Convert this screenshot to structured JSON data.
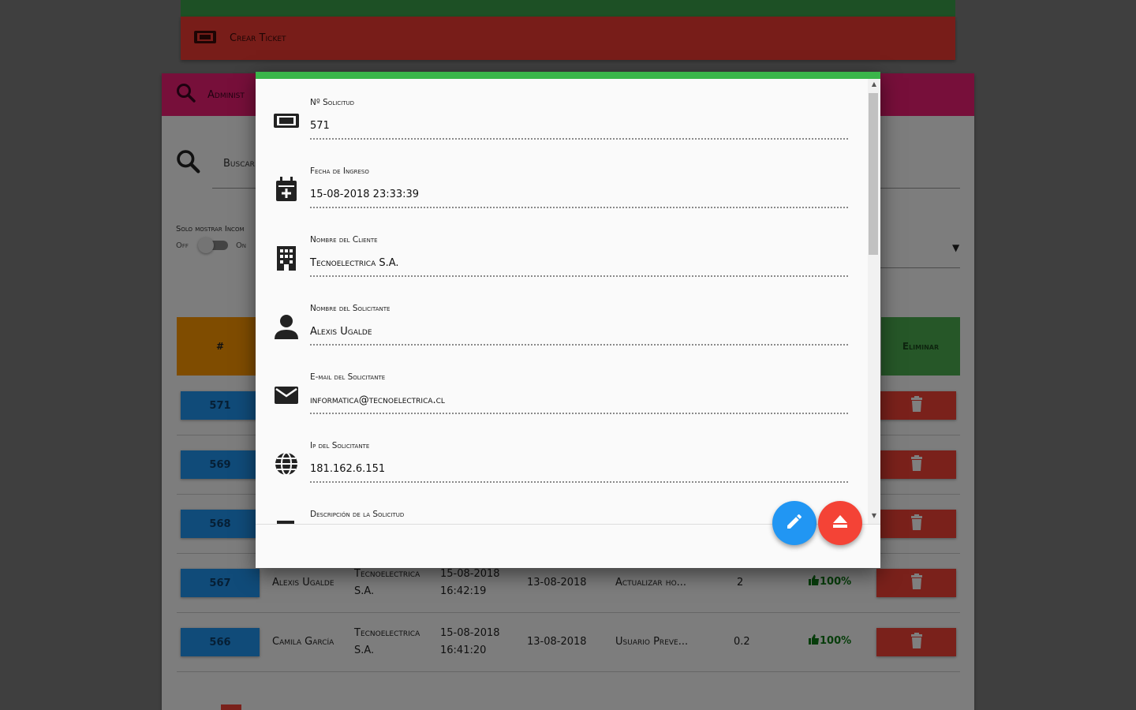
{
  "app": {
    "create_ticket_label": "Crear Ticket",
    "admin_label": "Administ",
    "search_label": "Buscar",
    "toggle_title": "Solo mostrar Incom",
    "toggle_off": "Off",
    "toggle_on": "On"
  },
  "table": {
    "header_hash": "#",
    "header_delete": "Eliminar",
    "rows": [
      {
        "num": "571"
      },
      {
        "num": "569"
      },
      {
        "num": "568"
      },
      {
        "num": "567",
        "solicitante": "Alexis Ugalde",
        "cliente_1": "Tecnoelectrica",
        "cliente_2": "S.A.",
        "ingreso_1": "15-08-2018",
        "ingreso_2": "16:42:19",
        "fecha": "13-08-2018",
        "descripcion": "Actualizar ho...",
        "horas": "2",
        "avance": "100%"
      },
      {
        "num": "566",
        "solicitante": "Camila García",
        "cliente_1": "Tecnoelectrica",
        "cliente_2": "S.A.",
        "ingreso_1": "15-08-2018",
        "ingreso_2": "16:41:20",
        "fecha": "13-08-2018",
        "descripcion": "Usuario Preve...",
        "horas": "0.2",
        "avance": "100%"
      }
    ]
  },
  "modal": {
    "fields": [
      {
        "label": "Nº Solicitud",
        "value": "571",
        "icon": "ticket-icon"
      },
      {
        "label": "Fecha de Ingreso",
        "value": "15-08-2018 23:33:39",
        "icon": "calendar-plus-icon"
      },
      {
        "label": "Nombre del Cliente",
        "value": "Tecnoelectrica S.A.",
        "icon": "building-icon"
      },
      {
        "label": "Nombre del Solicitante",
        "value": "Alexis Ugalde",
        "icon": "person-icon"
      },
      {
        "label": "E-mail del Solicitante",
        "value": "informatica@tecnoelectrica.cl",
        "icon": "email-icon"
      },
      {
        "label": "Ip del Solicitante",
        "value": "181.162.6.151",
        "icon": "globe-icon"
      },
      {
        "label": "Descripción de la Solicitud",
        "value": "",
        "icon": "description-icon"
      }
    ]
  },
  "colors": {
    "accent_green": "#3ab54a",
    "edit_blue": "#2196f3",
    "danger_red": "#f44336"
  }
}
